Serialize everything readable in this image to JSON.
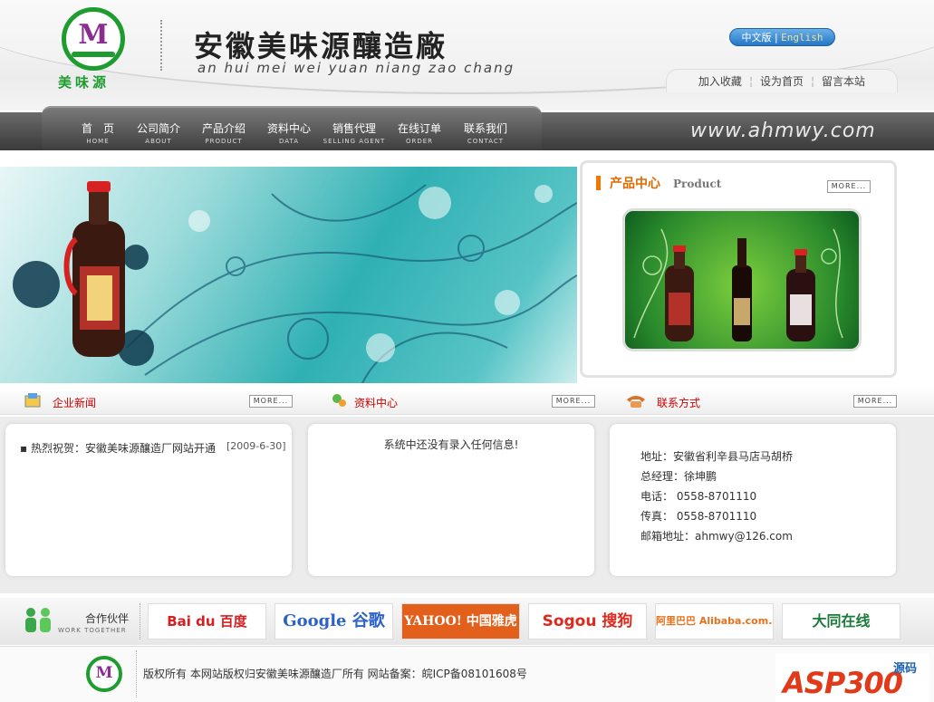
{
  "header": {
    "logo_text": "M",
    "logo_name": "美味源",
    "title": "安徽美味源釀造廠",
    "subtitle": "an hui mei wei yuan niang zao chang",
    "lang_zh": "中文版",
    "lang_sep": "|",
    "lang_en": "English",
    "links": [
      "加入收藏",
      "设为首页",
      "留言本站"
    ],
    "link_sep": "¦"
  },
  "nav": {
    "items": [
      {
        "zh": "首　页",
        "en": "HOME"
      },
      {
        "zh": "公司简介",
        "en": "ABOUT"
      },
      {
        "zh": "产品介绍",
        "en": "PRODUCT"
      },
      {
        "zh": "资料中心",
        "en": "DATA"
      },
      {
        "zh": "销售代理",
        "en": "SELLING AGENT"
      },
      {
        "zh": "在线订单",
        "en": "ORDER"
      },
      {
        "zh": "联系我们",
        "en": "CONTACT"
      }
    ],
    "url": "www.ahmwy.com"
  },
  "product": {
    "title_zh": "产品中心",
    "title_en": "Product",
    "more": "MORE..."
  },
  "sections": {
    "news": {
      "title": "企业新闻",
      "more": "MORE..."
    },
    "data": {
      "title": "资料中心",
      "more": "MORE..."
    },
    "contact": {
      "title": "联系方式",
      "more": "MORE..."
    }
  },
  "news": {
    "items": [
      {
        "text": "▪ 热烈祝贺：安徽美味源釀造厂网站开通",
        "date": "[2009-6-30]"
      }
    ]
  },
  "data_box": {
    "empty_text": "系统中还没有录入任何信息!"
  },
  "contact": {
    "address": "地址：安徽省利辛县马店马胡桥",
    "manager": "总经理：徐坤鹏",
    "phone": "电话： 0558-8701110",
    "fax": "传真： 0558-8701110",
    "email": "邮箱地址：ahmwy@126.com"
  },
  "partners": {
    "title_zh": "合作伙伴",
    "title_en": "WORK TOGETHER",
    "logos": [
      "Bai du 百度",
      "Google 谷歌",
      "YAHOO! 中国雅虎",
      "Sogou 搜狗",
      "阿里巴巴 Alibaba.com.cn",
      "大同在线"
    ]
  },
  "footer": {
    "copyright": "版权所有 本网站版权归安徽美味源釀造厂所有 网站备案：皖ICP备08101608号",
    "watermark": "ASP300",
    "watermark_sub": "源码"
  },
  "colors": {
    "accent_green": "#1e9c2f",
    "accent_orange": "#e06a00",
    "section_red": "#cc0000",
    "nav_dark": "#3a3a3a"
  }
}
